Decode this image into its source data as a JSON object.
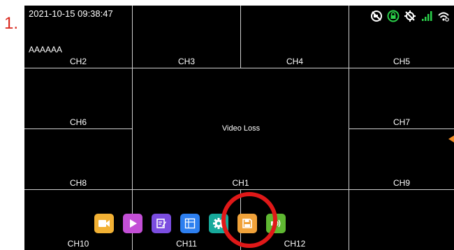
{
  "step_number": "1.",
  "overlay": {
    "timestamp": "2021-10-15 09:38:47",
    "device_name": "AAAAAA",
    "video_loss": "Video Loss"
  },
  "channels": {
    "ch1": "CH1",
    "ch2": "CH2",
    "ch3": "CH3",
    "ch4": "CH4",
    "ch5": "CH5",
    "ch6": "CH6",
    "ch7": "CH7",
    "ch8": "CH8",
    "ch9": "CH9",
    "ch10": "CH10",
    "ch11": "CH11",
    "ch12": "CH12"
  },
  "status_icons": [
    "no-camera-icon",
    "lock-icon",
    "gps-off-icon",
    "signal-icon",
    "wifi-icon"
  ],
  "toolbar": [
    {
      "name": "record-button",
      "icon": "video-camera-icon",
      "color": "#f2b134"
    },
    {
      "name": "playback-button",
      "icon": "play-icon",
      "color": "#c34fd6"
    },
    {
      "name": "log-button",
      "icon": "edit-icon",
      "color": "#7b4de0"
    },
    {
      "name": "layout-button",
      "icon": "grid-icon",
      "color": "#2d7ff0"
    },
    {
      "name": "settings-button",
      "icon": "gear-icon",
      "color": "#17a99b"
    },
    {
      "name": "storage-button",
      "icon": "save-icon",
      "color": "#f0a23a"
    },
    {
      "name": "volume-button",
      "icon": "speaker-icon",
      "color": "#5fb832"
    }
  ],
  "colors": {
    "highlight_ring": "#e01818",
    "step_number": "#d9261c",
    "status_ok": "#2bd24b"
  }
}
